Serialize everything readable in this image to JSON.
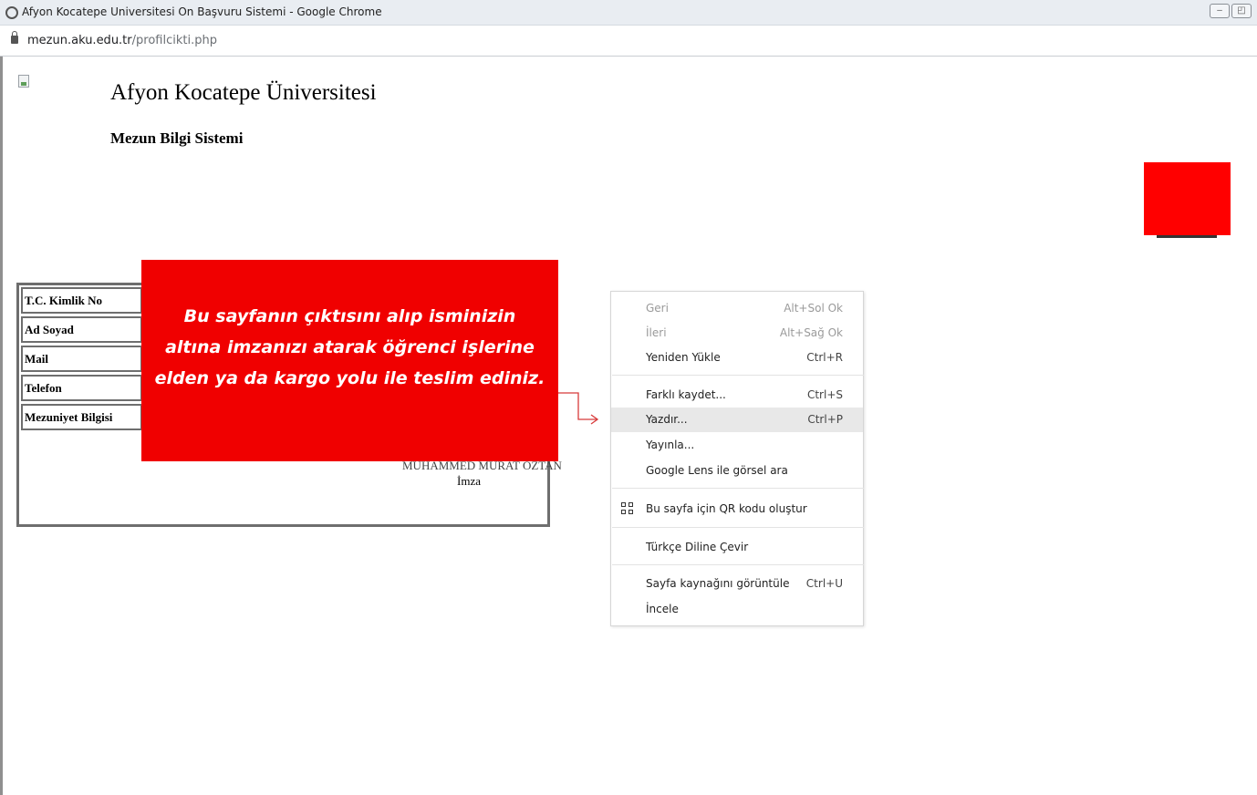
{
  "window": {
    "title": "Afyon Kocatepe Universitesi On Başvuru Sistemi - Google Chrome"
  },
  "address_bar": {
    "domain": "mezun.aku.edu.tr",
    "path": "/profilcikti.php"
  },
  "page": {
    "university": "Afyon Kocatepe Üniversitesi",
    "system": "Mezun Bilgi Sistemi",
    "fields": [
      {
        "label": "T.C. Kimlik No"
      },
      {
        "label": "Ad Soyad"
      },
      {
        "label": "Mail"
      },
      {
        "label": "Telefon"
      },
      {
        "label": "Mezuniyet Bilgisi"
      }
    ],
    "signature_name": "MUHAMMED MURAT OZTAN",
    "signature_label": "İmza",
    "photo_color": "#ff0000"
  },
  "callout": {
    "text": "Bu sayfanın çıktısını alıp isminizin altına imzanızı atarak öğrenci işlerine elden ya da kargo yolu ile teslim ediniz.",
    "background": "#f00000"
  },
  "context_menu": {
    "items": [
      {
        "label": "Geri",
        "shortcut": "Alt+Sol Ok"
      },
      {
        "label": "İleri",
        "shortcut": "Alt+Sağ Ok"
      },
      {
        "label": "Yeniden Yükle",
        "shortcut": "Ctrl+R"
      },
      {
        "label": "Farklı kaydet...",
        "shortcut": "Ctrl+S"
      },
      {
        "label": "Yazdır...",
        "shortcut": "Ctrl+P"
      },
      {
        "label": "Yayınla...",
        "shortcut": ""
      },
      {
        "label": "Google Lens ile görsel ara",
        "shortcut": ""
      },
      {
        "label": "Bu sayfa için QR kodu oluştur",
        "shortcut": ""
      },
      {
        "label": "Türkçe Diline Çevir",
        "shortcut": ""
      },
      {
        "label": "Sayfa kaynağını görüntüle",
        "shortcut": "Ctrl+U"
      },
      {
        "label": "İncele",
        "shortcut": ""
      }
    ]
  }
}
